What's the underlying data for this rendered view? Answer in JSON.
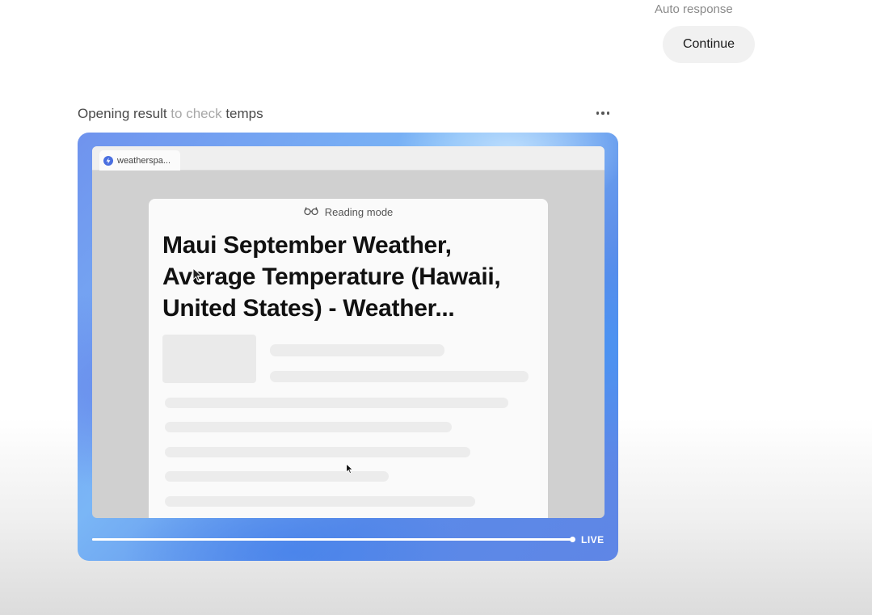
{
  "chat": {
    "auto_response_label": "Auto response",
    "continue_label": "Continue"
  },
  "step": {
    "title_start": "Opening result ",
    "title_faded": "to check",
    "title_end": " temps",
    "more_icon": "ellipsis-icon"
  },
  "browser": {
    "tab_label": "weatherspa...",
    "favicon_icon": "weatherspark-favicon-icon",
    "reading_mode_label": "Reading mode",
    "reading_mode_icon": "glasses-icon",
    "page_title": "Maui September Weather, Average Temperature (Hawaii, United States) - Weather..."
  },
  "playback": {
    "live_label": "LIVE",
    "progress": 1.0
  },
  "colors": {
    "card_accent": "#6f93ee",
    "continue_bg": "#f1f1f1"
  }
}
